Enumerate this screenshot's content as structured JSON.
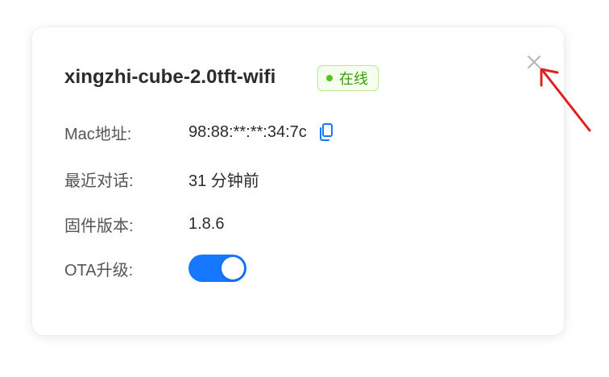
{
  "device": {
    "name": "xingzhi-cube-2.0tft-wifi",
    "status": "在线"
  },
  "fields": {
    "mac_label": "Mac地址:",
    "mac_value": "98:88:**:**:34:7c",
    "last_chat_label": "最近对话:",
    "last_chat_value": "31 分钟前",
    "firmware_label": "固件版本:",
    "firmware_value": "1.8.6",
    "ota_label": "OTA升级:",
    "ota_enabled": true
  },
  "colors": {
    "accent": "#1677ff",
    "online": "#52c41a",
    "annotation_arrow": "#e02020"
  },
  "icons": {
    "close": "close-icon",
    "copy": "copy-icon"
  }
}
